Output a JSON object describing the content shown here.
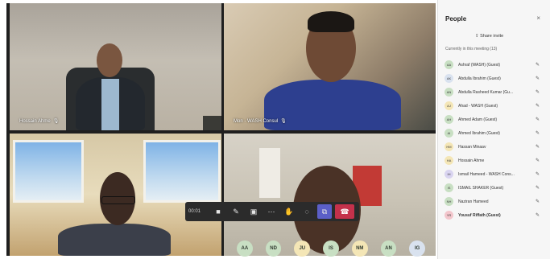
{
  "tiles": {
    "top_left_name": "Hossain Ahme",
    "top_right_name": "Mon - WASH Consul"
  },
  "toolbar": {
    "time": "00:01",
    "icons": [
      "camera-icon",
      "microphone-icon",
      "share-screen-icon",
      "more-icon",
      "raise-hand-icon",
      "chat-icon",
      "participants-icon",
      "hang-up-icon"
    ]
  },
  "avatars": [
    {
      "initials": "AA",
      "color": "#c8dfc3"
    },
    {
      "initials": "ND",
      "color": "#c8dfc3"
    },
    {
      "initials": "JU",
      "color": "#f4e6b6"
    },
    {
      "initials": "IS",
      "color": "#c8dfc3"
    },
    {
      "initials": "NM",
      "color": "#f4e6b6"
    },
    {
      "initials": "AN",
      "color": "#c8dfc3"
    },
    {
      "initials": "IG",
      "color": "#d9e2ef"
    }
  ],
  "panel": {
    "title": "People",
    "close": "×",
    "share_invite": "Share invite",
    "section": "Currently in this meeting (13)",
    "people": [
      {
        "initials": "AA",
        "name": "Ashraf (WASH) (Guest)",
        "color": "#c8dfc3"
      },
      {
        "initials": "AK",
        "name": "Abdulla Ibrahim (Guest)",
        "color": "#d9e2ef"
      },
      {
        "initials": "AN",
        "name": "Abdulla Rasheed Kumar (Gu...",
        "color": "#c8dfc3"
      },
      {
        "initials": "AJ",
        "name": "Ahad - WASH (Guest)",
        "color": "#f4e6b6"
      },
      {
        "initials": "AH",
        "name": "Ahmed Adam (Guest)",
        "color": "#c8dfc3"
      },
      {
        "initials": "AI",
        "name": "Ahmed Ibrahim (Guest)",
        "color": "#c8dfc3"
      },
      {
        "initials": "HM",
        "name": "Hassan Minaav",
        "color": "#f4e6b6"
      },
      {
        "initials": "HA",
        "name": "Hossain Ahme",
        "color": "#f4e6b6"
      },
      {
        "initials": "IH",
        "name": "Ismail Hameed - WASH Cons...",
        "color": "#d9d4f0"
      },
      {
        "initials": "IS",
        "name": "ISMAIL SHAKER (Guest)",
        "color": "#c8dfc3"
      },
      {
        "initials": "NH",
        "name": "Naziran Hameed",
        "color": "#c8dfc3"
      },
      {
        "initials": "YR",
        "name": "Yousuf Riffath (Guest)",
        "color": "#f3c6cc",
        "bold": true
      }
    ]
  }
}
